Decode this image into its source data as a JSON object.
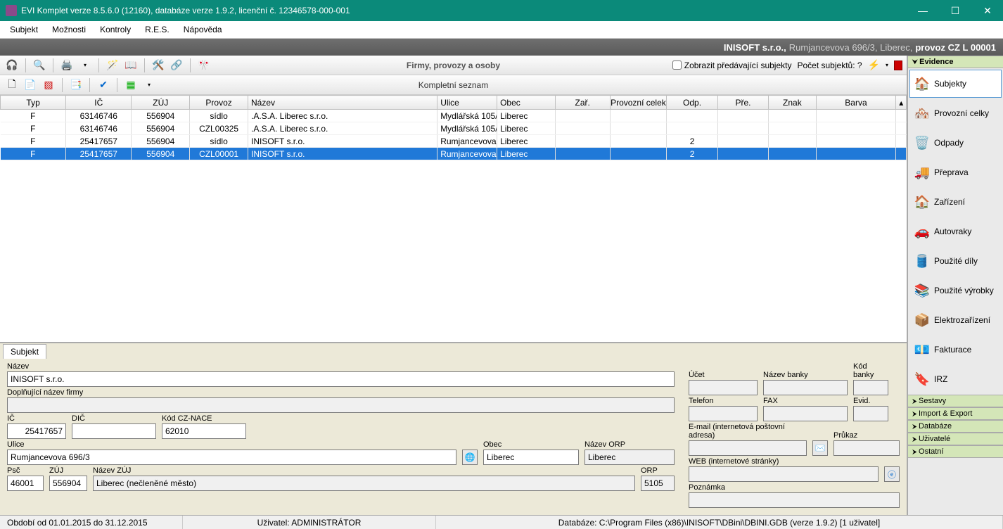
{
  "window": {
    "title": "EVI Komplet verze 8.5.6.0 (12160), databáze verze 1.9.2, licenční č. 12346578-000-001"
  },
  "menubar": [
    "Subjekt",
    "Možnosti",
    "Kontroly",
    "R.E.S.",
    "Nápověda"
  ],
  "banner": {
    "company": "INISOFT s.r.o.,",
    "address": "Rumjancevova 696/3, Liberec,",
    "provoz": "provoz  CZ L 00001"
  },
  "toolbar1": {
    "center": "Firmy, provozy a osoby",
    "checkbox": "Zobrazit předávající subjekty",
    "count_label": "Počet subjektů: ?"
  },
  "toolbar2": {
    "center": "Kompletní seznam"
  },
  "grid": {
    "headers": [
      "Typ",
      "IČ",
      "ZÚJ",
      "Provoz",
      "Název",
      "Ulice",
      "Obec",
      "Zař.",
      "Provozní celek",
      "Odp.",
      "Pře.",
      "Znak",
      "Barva"
    ],
    "rows": [
      {
        "typ": "F",
        "ic": "63146746",
        "zuj": "556904",
        "provoz": "sídlo",
        "nazev": ".A.S.A. Liberec s.r.o.",
        "ulice": "Mydlářská 105/",
        "obec": "Liberec",
        "zar": "",
        "pcelek": "",
        "odp": "",
        "pre": "",
        "znak": "",
        "barva": ""
      },
      {
        "typ": "F",
        "ic": "63146746",
        "zuj": "556904",
        "provoz": "CZL00325",
        "nazev": ".A.S.A. Liberec s.r.o.",
        "ulice": "Mydlářská 105/",
        "obec": "Liberec",
        "zar": "",
        "pcelek": "",
        "odp": "",
        "pre": "",
        "znak": "",
        "barva": ""
      },
      {
        "typ": "F",
        "ic": "25417657",
        "zuj": "556904",
        "provoz": "sídlo",
        "nazev": "INISOFT s.r.o.",
        "ulice": "Rumjancevova",
        "obec": "Liberec",
        "zar": "",
        "pcelek": "",
        "odp": "2",
        "pre": "",
        "znak": "",
        "barva": ""
      },
      {
        "typ": "F",
        "ic": "25417657",
        "zuj": "556904",
        "provoz": "CZL00001",
        "nazev": "INISOFT s.r.o.",
        "ulice": "Rumjancevova",
        "obec": "Liberec",
        "zar": "",
        "pcelek": "",
        "odp": "2",
        "pre": "",
        "znak": "",
        "barva": "",
        "selected": true
      }
    ]
  },
  "detail": {
    "tab": "Subjekt",
    "labels": {
      "nazev": "Název",
      "dopln": "Doplňující název firmy",
      "ic": "IČ",
      "dic": "DIČ",
      "nace": "Kód CZ-NACE",
      "ulice": "Ulice",
      "obec": "Obec",
      "nazev_orp": "Název ORP",
      "psc": "Psč",
      "zuj": "ZÚJ",
      "nazev_zuj": "Název ZÚJ",
      "orp": "ORP",
      "ucet": "Účet",
      "nazev_banky": "Název banky",
      "kod_banky": "Kód banky",
      "telefon": "Telefon",
      "fax": "FAX",
      "evid": "Evid.",
      "email": "E-mail (internetová poštovní adresa)",
      "prukaz": "Průkaz",
      "web": "WEB (internetové stránky)",
      "poznamka": "Poznámka"
    },
    "values": {
      "nazev": "INISOFT s.r.o.",
      "dopln": "",
      "ic": "25417657",
      "dic": "",
      "nace": "62010",
      "ulice": "Rumjancevova 696/3",
      "obec": "Liberec",
      "nazev_orp": "Liberec",
      "psc": "46001",
      "zuj": "556904",
      "nazev_zuj": "Liberec (nečleněné město)",
      "orp": "5105",
      "ucet": "",
      "nazev_banky": "",
      "kod_banky": "",
      "telefon": "",
      "fax": "",
      "evid": "",
      "email": "",
      "prukaz": "",
      "web": "",
      "poznamka": ""
    }
  },
  "sidebar": {
    "sections": [
      {
        "title": "Evidence",
        "active": true,
        "items": [
          {
            "label": "Subjekty",
            "icon": "🏠",
            "selected": true
          },
          {
            "label": "Provozní celky",
            "icon": "🏘️"
          },
          {
            "label": "Odpady",
            "icon": "🗑️"
          },
          {
            "label": "Přeprava",
            "icon": "🚚"
          },
          {
            "label": "Zařízení",
            "icon": "🏠"
          },
          {
            "label": "Autovraky",
            "icon": "🚗"
          },
          {
            "label": "Použité díly",
            "icon": "🛢️"
          },
          {
            "label": "Použité výrobky",
            "icon": "📚"
          },
          {
            "label": "Elektrozařízení",
            "icon": "📦"
          },
          {
            "label": "Fakturace",
            "icon": "💶"
          },
          {
            "label": "IRZ",
            "icon": "🔖"
          }
        ]
      },
      {
        "title": "Sestavy"
      },
      {
        "title": "Import & Export"
      },
      {
        "title": "Databáze"
      },
      {
        "title": "Uživatelé"
      },
      {
        "title": "Ostatní"
      }
    ]
  },
  "statusbar": {
    "period": "Období od 01.01.2015 do 31.12.2015",
    "user": "Uživatel: ADMINISTRÁTOR",
    "db": "Databáze: C:\\Program Files (x86)\\INISOFT\\DBini\\DBINI.GDB  (verze 1.9.2) [1 uživatel]"
  }
}
